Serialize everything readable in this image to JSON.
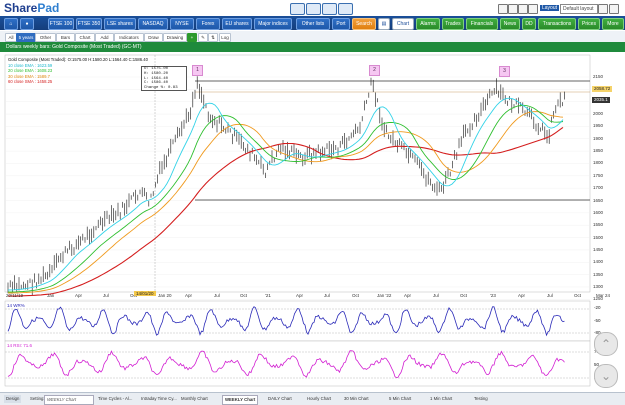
{
  "app": {
    "logo_share": "Share",
    "logo_pad": "Pad"
  },
  "layout": {
    "label": "Layout",
    "value": "Default layout"
  },
  "nav": {
    "items": [
      "FTSE 100",
      "FTSE 350",
      "LSE shares",
      "NASDAQ",
      "NYSE",
      "Forex",
      "EU shares",
      "Major indices",
      "Other lists",
      "Port",
      "Search",
      "Chart",
      "Alarms",
      "Trades",
      "Financials",
      "News",
      "DD",
      "Transactions",
      "Prices",
      "More"
    ]
  },
  "toolbar": {
    "items": [
      "All",
      "5 years",
      "Other",
      "Bars",
      "Chart",
      "Add",
      "Indicators",
      "Draw",
      "Drawing",
      "Log"
    ]
  },
  "title_bar": "Dollars weekly bars: Gold Composite (Most Traded) (GC-MT)",
  "legend": {
    "line1": "Gold Composite (Most Traded): O:1575.00 H:1580.20 L:1564.40 C:1586.40",
    "line2": "10 close EMA : 1623.59",
    "line3": "20 close EMA : 1608.23",
    "line4": "30 close EMA : 1589.7",
    "line5": "60 close SMA : 1458.25"
  },
  "infobox": {
    "open": "O: 1575.00",
    "high": "H: 1580.20",
    "low": "L: 1564.40",
    "close": "C: 1586.40",
    "change": "Change %: 0.83"
  },
  "markers": [
    "1",
    "2",
    "3"
  ],
  "y_axis": [
    "2150",
    "2100",
    "2050",
    "2000",
    "1950",
    "1900",
    "1850",
    "1800",
    "1750",
    "1700",
    "1650",
    "1600",
    "1550",
    "1500",
    "1450",
    "1400",
    "1350",
    "1300",
    "1250"
  ],
  "x_axis": [
    "20/11/19",
    "Jan",
    "Apr",
    "Jul",
    "Oct",
    "Jan 20",
    "Apr",
    "Jul",
    "Oct",
    "'21",
    "Apr",
    "Jul",
    "Oct",
    "Jan '22",
    "Apr",
    "Jul",
    "Oct",
    "'23",
    "Apr",
    "Jul",
    "Oct",
    "Jan 24",
    "Mar 24"
  ],
  "x_cursor_label": "14/01/20",
  "price_tags": {
    "last": "2058.72",
    "close": "2035.1"
  },
  "indicators": {
    "wr_label": "14 WR%",
    "wr_levels": [
      "-20",
      "-50",
      "-80"
    ],
    "rsi_label": "14 RSI: 71.6",
    "rsi_levels": [
      "70",
      "50",
      "30"
    ]
  },
  "bottom_tabs": {
    "design": "Design",
    "setting_label": "Setting:",
    "setting_value": "WEEKLY Chart",
    "tabs": [
      "Time Cycles - Al...",
      "Intraday Time Cy...",
      "Monthly Chart",
      "WEEKLY Chart",
      "DAILY Chart",
      "Hourly Chart",
      "30 Min Chart",
      "5 Min Chart",
      "1 Min Chart",
      "Testing"
    ]
  },
  "colors": {
    "nav_bg": "#1a4f99",
    "title_bg": "#1f8a3c",
    "ema10": "#34d3e8",
    "ema20": "#2fbf2f",
    "ema30": "#f09a1e",
    "sma60": "#d41e1e",
    "wr_line": "#2a2ab8",
    "rsi_line": "#d21ed2",
    "marker_fill": "#f6c7f2"
  }
}
